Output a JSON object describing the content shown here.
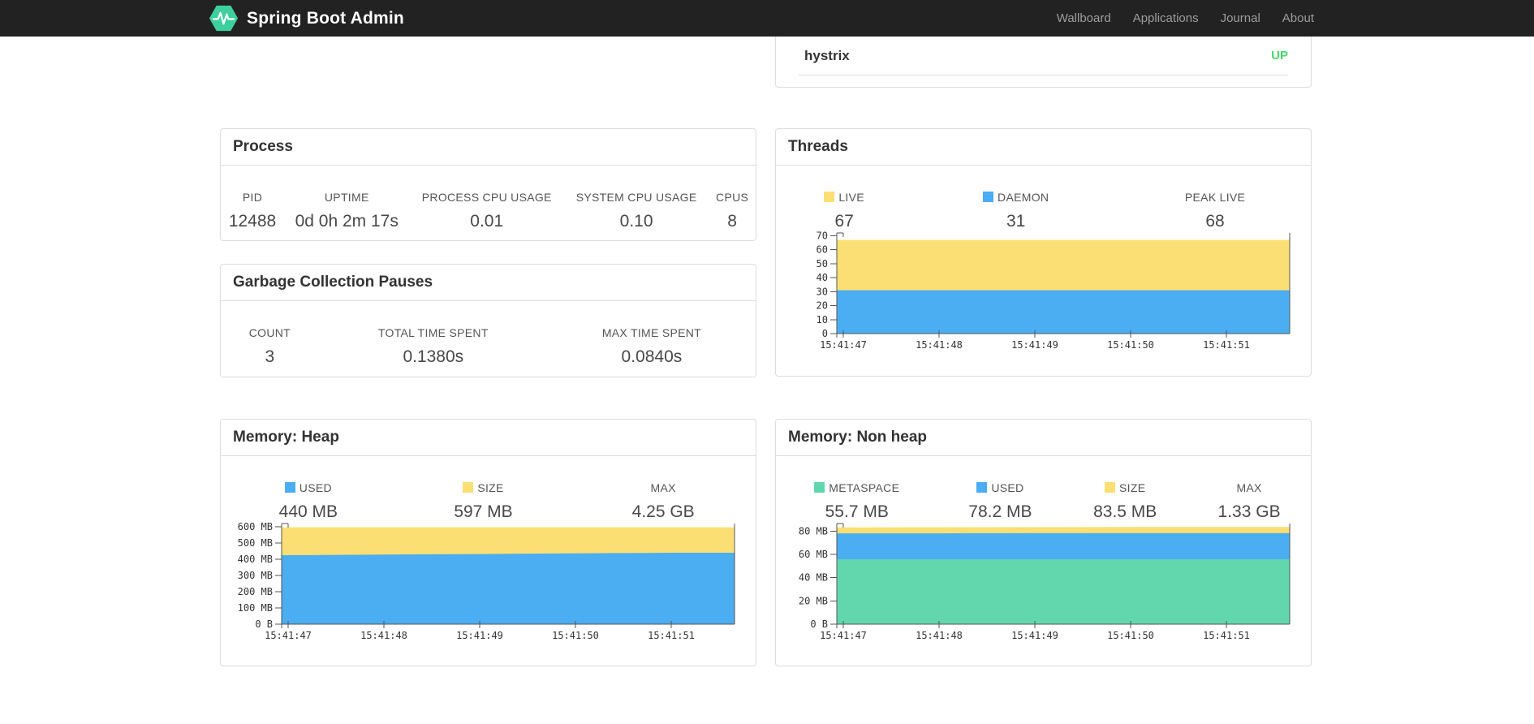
{
  "navbar": {
    "brand": "Spring Boot Admin",
    "items": [
      {
        "label": "Wallboard"
      },
      {
        "label": "Applications"
      },
      {
        "label": "Journal"
      },
      {
        "label": "About"
      }
    ]
  },
  "health": {
    "rows": [
      {
        "name": "hystrix",
        "status": "UP"
      }
    ]
  },
  "panels": {
    "process": {
      "title": "Process",
      "stats": [
        {
          "label": "PID",
          "value": "12488"
        },
        {
          "label": "UPTIME",
          "value": "0d 0h 2m 17s"
        },
        {
          "label": "PROCESS CPU USAGE",
          "value": "0.01"
        },
        {
          "label": "SYSTEM CPU USAGE",
          "value": "0.10"
        },
        {
          "label": "CPUS",
          "value": "8"
        }
      ]
    },
    "gc": {
      "title": "Garbage Collection Pauses",
      "stats": [
        {
          "label": "COUNT",
          "value": "3"
        },
        {
          "label": "TOTAL TIME SPENT",
          "value": "0.1380s"
        },
        {
          "label": "MAX TIME SPENT",
          "value": "0.0840s"
        }
      ]
    },
    "threads": {
      "title": "Threads",
      "stats": [
        {
          "label": "LIVE",
          "value": "67",
          "color": "#fbdf74"
        },
        {
          "label": "DAEMON",
          "value": "31",
          "color": "#4badf2"
        },
        {
          "label": "PEAK LIVE",
          "value": "68"
        }
      ]
    },
    "heap": {
      "title": "Memory: Heap",
      "stats": [
        {
          "label": "USED",
          "value": "440 MB",
          "color": "#4badf2"
        },
        {
          "label": "SIZE",
          "value": "597 MB",
          "color": "#fbdf74"
        },
        {
          "label": "MAX",
          "value": "4.25 GB"
        }
      ]
    },
    "nonheap": {
      "title": "Memory: Non heap",
      "stats": [
        {
          "label": "METASPACE",
          "value": "55.7 MB",
          "color": "#62d7ae"
        },
        {
          "label": "USED",
          "value": "78.2 MB",
          "color": "#4badf2"
        },
        {
          "label": "SIZE",
          "value": "83.5 MB",
          "color": "#fbdf74"
        },
        {
          "label": "MAX",
          "value": "1.33 GB"
        }
      ]
    }
  },
  "colors": {
    "navbar_bg": "#222222",
    "nav_link": "#9d9d9d",
    "brand_text": "#ffffff",
    "logo_green": "#3ecf9f",
    "panel_border": "#dddddd",
    "status_up": "#42d96b",
    "chart_yellow": "#fbdf74",
    "chart_blue": "#4badf2",
    "chart_green": "#62d7ae",
    "axis": "#545454"
  },
  "chart_data": [
    {
      "id": "threads",
      "type": "area",
      "title": "Threads",
      "x": [
        "15:41:47",
        "15:41:48",
        "15:41:49",
        "15:41:50",
        "15:41:51"
      ],
      "xlabel": "",
      "ylabel": "",
      "ylim": [
        0,
        72
      ],
      "grid": false,
      "legend_position": "top",
      "yticks": [
        {
          "v": 0,
          "label": "0"
        },
        {
          "v": 10,
          "label": "10"
        },
        {
          "v": 20,
          "label": "20"
        },
        {
          "v": 30,
          "label": "30"
        },
        {
          "v": 40,
          "label": "40"
        },
        {
          "v": 50,
          "label": "50"
        },
        {
          "v": 60,
          "label": "60"
        },
        {
          "v": 70,
          "label": "70"
        }
      ],
      "series": [
        {
          "name": "LIVE",
          "color": "#fbdf74",
          "values": [
            67,
            67,
            67,
            67,
            67
          ]
        },
        {
          "name": "DAEMON",
          "color": "#4badf2",
          "values": [
            31,
            31,
            31,
            31,
            31
          ]
        }
      ]
    },
    {
      "id": "heap",
      "type": "area",
      "title": "Memory: Heap",
      "x": [
        "15:41:47",
        "15:41:48",
        "15:41:49",
        "15:41:50",
        "15:41:51"
      ],
      "xlabel": "",
      "ylabel": "",
      "ylim": [
        0,
        620
      ],
      "grid": false,
      "legend_position": "top",
      "yticks": [
        {
          "v": 0,
          "label": "0 B"
        },
        {
          "v": 100,
          "label": "100 MB"
        },
        {
          "v": 200,
          "label": "200 MB"
        },
        {
          "v": 300,
          "label": "300 MB"
        },
        {
          "v": 400,
          "label": "400 MB"
        },
        {
          "v": 500,
          "label": "500 MB"
        },
        {
          "v": 600,
          "label": "600 MB"
        }
      ],
      "series": [
        {
          "name": "SIZE",
          "color": "#fbdf74",
          "values": [
            597,
            597,
            597,
            597,
            597
          ]
        },
        {
          "name": "USED",
          "color": "#4badf2",
          "values": [
            425,
            429,
            432,
            436,
            440
          ]
        }
      ]
    },
    {
      "id": "nonheap",
      "type": "area",
      "title": "Memory: Non heap",
      "x": [
        "15:41:47",
        "15:41:48",
        "15:41:49",
        "15:41:50",
        "15:41:51"
      ],
      "xlabel": "",
      "ylabel": "",
      "ylim": [
        0,
        86.5
      ],
      "grid": false,
      "legend_position": "top",
      "yticks": [
        {
          "v": 0,
          "label": "0 B"
        },
        {
          "v": 20,
          "label": "20 MB"
        },
        {
          "v": 40,
          "label": "40 MB"
        },
        {
          "v": 60,
          "label": "60 MB"
        },
        {
          "v": 80,
          "label": "80 MB"
        }
      ],
      "series": [
        {
          "name": "SIZE",
          "color": "#fbdf74",
          "values": [
            83.2,
            83.3,
            83.4,
            83.5,
            83.5
          ]
        },
        {
          "name": "USED",
          "color": "#4badf2",
          "values": [
            78.0,
            78.0,
            78.2,
            78.2,
            78.2
          ]
        },
        {
          "name": "METASPACE",
          "color": "#62d7ae",
          "values": [
            55.7,
            55.7,
            55.7,
            55.7,
            55.7
          ]
        }
      ]
    }
  ]
}
